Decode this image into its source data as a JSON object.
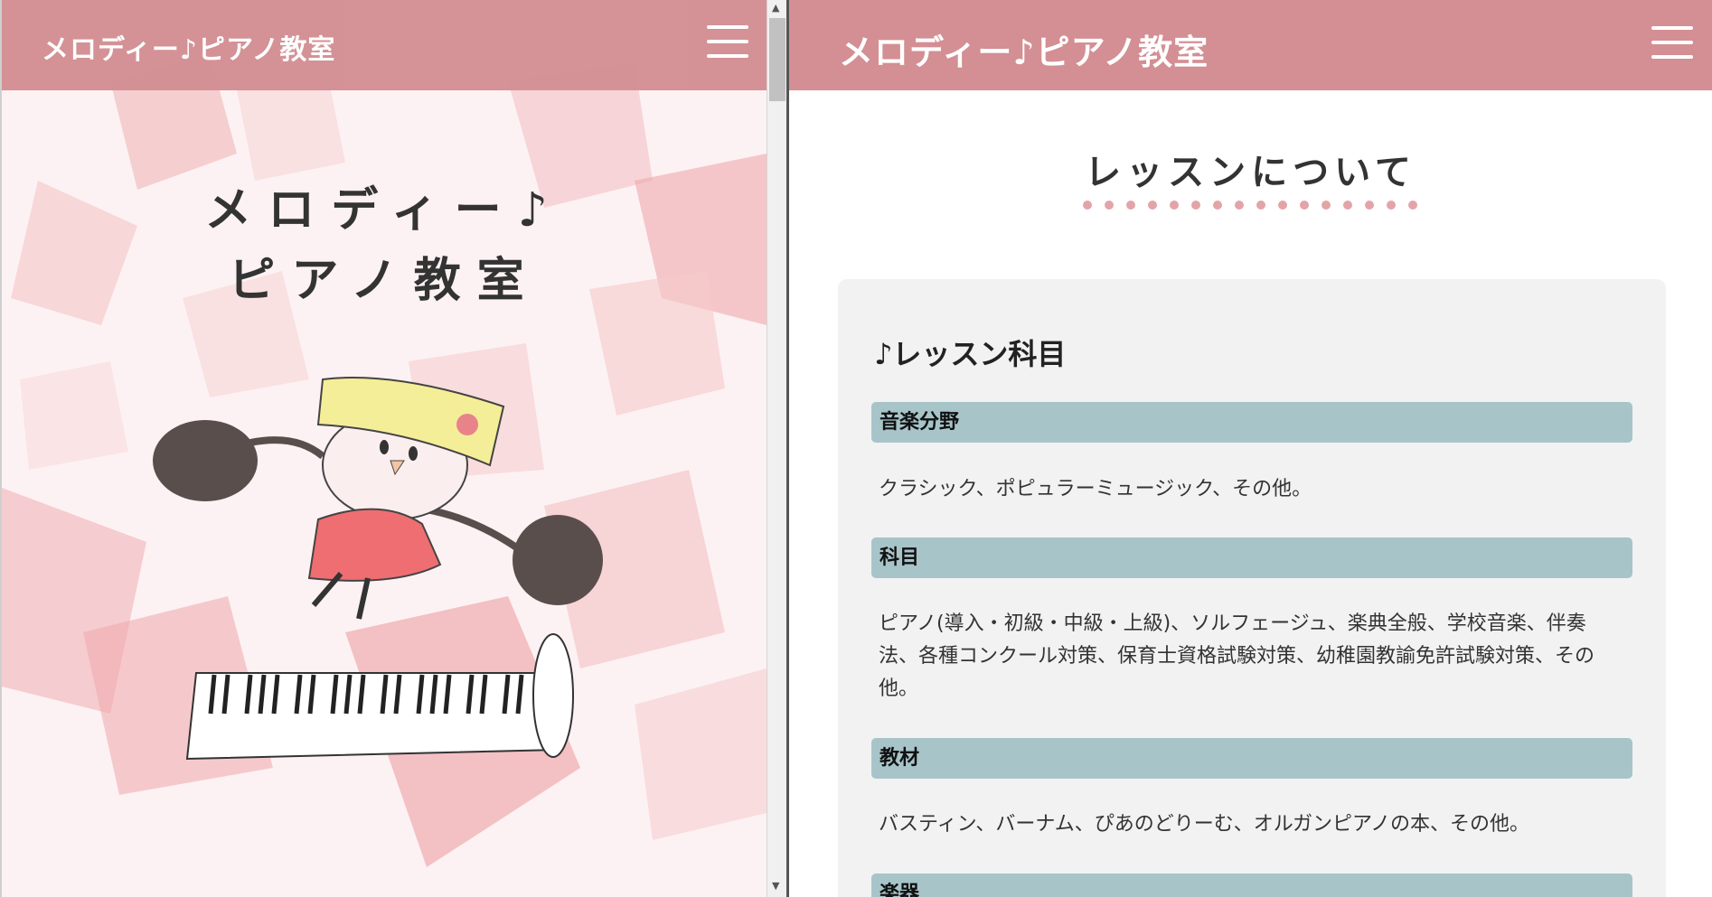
{
  "left_pane": {
    "brand": "メロディー♪ピアノ教室",
    "hero": {
      "line1": "メロディー♪",
      "line2": "ピアノ教室"
    },
    "menu_icon": "hamburger-menu-icon",
    "illustration": "piano-girl-illustration"
  },
  "right_pane": {
    "brand": "メロディー♪ピアノ教室",
    "menu_icon": "hamburger-menu-icon",
    "section_heading": "レッスンについて",
    "card": {
      "title": "♪レッスン科目",
      "items": [
        {
          "label": "音楽分野",
          "text": "クラシック、ポピュラーミュージック、その他。"
        },
        {
          "label": "科目",
          "text": "ピアノ(導入・初級・中級・上級)、ソルフェージュ、楽典全般、学校音楽、伴奏法、各種コンクール対策、保育士資格試験対策、幼稚園教諭免許試験対策、その他。"
        },
        {
          "label": "教材",
          "text": "バスティン、バーナム、ぴあのどりーむ、オルガンピアノの本、その他。"
        },
        {
          "label": "楽器",
          "text": ""
        }
      ]
    }
  },
  "colors": {
    "header": "#d38f93",
    "label_bar": "#a7c4c9",
    "card_bg": "#f2f2f2",
    "dots": "#e3a4a8"
  }
}
